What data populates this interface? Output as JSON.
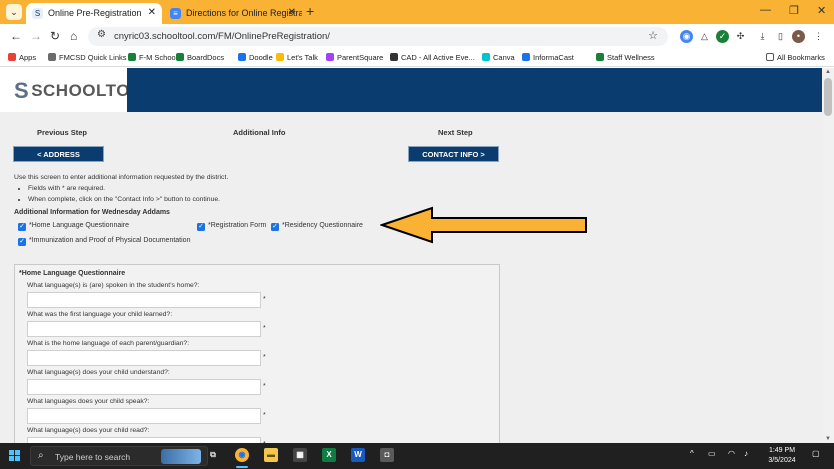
{
  "browser": {
    "tabs": [
      {
        "title": "Online Pre-Registration",
        "active": true
      },
      {
        "title": "Directions for Online Registratio",
        "active": false
      }
    ],
    "url": "cnyric03.schooltool.com/FM/OnlinePreRegistration/",
    "bookmarks": [
      {
        "label": "Apps",
        "color": "#e94235"
      },
      {
        "label": "FMCSD Quick Links",
        "color": "#6b6b6b"
      },
      {
        "label": "F-M Schools",
        "color": "#188038"
      },
      {
        "label": "BoardDocs",
        "color": "#188038"
      },
      {
        "label": "Doodle",
        "color": "#1a73e8"
      },
      {
        "label": "Let's Talk",
        "color": "#fbbc04"
      },
      {
        "label": "ParentSquare",
        "color": "#a142f4"
      },
      {
        "label": "CAD - All Active Eve...",
        "color": "#333333"
      },
      {
        "label": "Canva",
        "color": "#00c4cc"
      },
      {
        "label": "InformaCast",
        "color": "#1a73e8"
      },
      {
        "label": "Staff Wellness",
        "color": "#188038"
      }
    ],
    "all_bookmarks": "All Bookmarks"
  },
  "site": {
    "logo_text": "SCHOOLTOOL",
    "brand_color": "#0b3c6f"
  },
  "steps": {
    "previous_label": "Previous Step",
    "current_label": "Additional Info",
    "next_label": "Next Step",
    "back_button": "< ADDRESS",
    "next_button": "CONTACT INFO >"
  },
  "instructions": {
    "intro": "Use this screen to enter additional information requested by the district.",
    "bullets": [
      "Fields with * are required.",
      "When complete, click on the \"Contact Info >\" button to continue."
    ]
  },
  "additional": {
    "heading": "Additional Information for Wednesday Addams",
    "checkboxes": [
      "*Home Language Questionnaire",
      "*Registration Form",
      "*Residency Questionnaire",
      "*Immunization and Proof of Physical Documentation"
    ]
  },
  "questionnaire": {
    "title": "*Home Language Questionnaire",
    "questions": [
      "What language(s) is (are) spoken in the student's home?:",
      "What was the first language your child learned?:",
      "What is the home language of each parent/guardian?:",
      "What language(s) does your child understand?:",
      "What languages does your child speak?:",
      "What language(s) does your child read?:"
    ],
    "required_mark": "*"
  },
  "taskbar": {
    "search_placeholder": "Type here to search",
    "time": "1:49 PM",
    "date": "3/5/2024"
  },
  "colors": {
    "tab_bar": "#f9b234",
    "arrow": "#f9b234",
    "checkbox": "#1a73e8"
  }
}
